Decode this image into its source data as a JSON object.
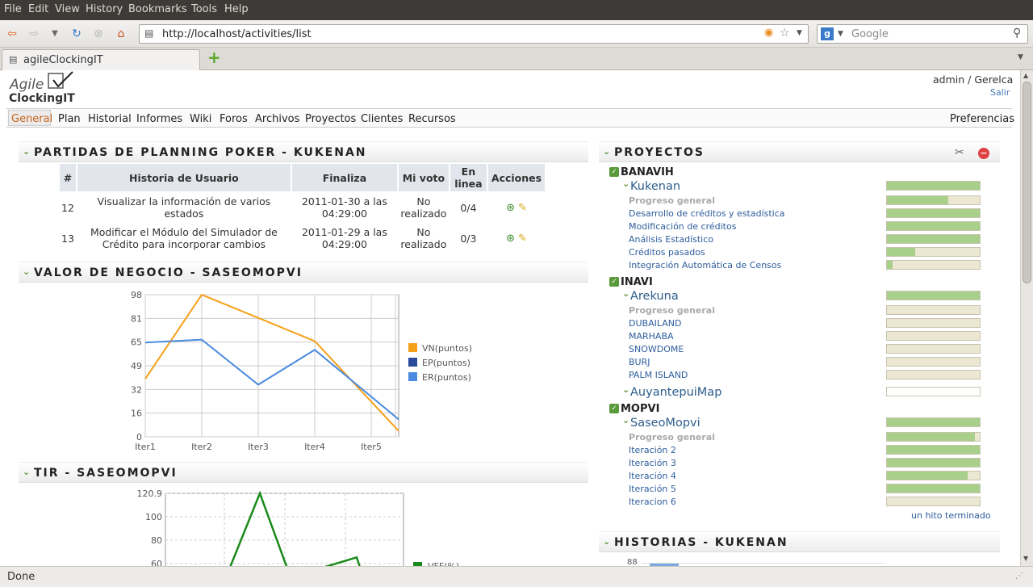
{
  "browser": {
    "menu": [
      "File",
      "Edit",
      "View",
      "History",
      "Bookmarks",
      "Tools",
      "Help"
    ],
    "url": "http://localhost/activities/list",
    "search_placeholder": "Google",
    "tab_title": "agileClockingIT",
    "status": "Done"
  },
  "app": {
    "logo_line1": "Agile",
    "logo_line2": "ClockingIT",
    "user": "admin / Gerelca",
    "logout": "Salir",
    "nav": [
      "General",
      "Plan",
      "Historial",
      "Informes",
      "Wiki",
      "Foros",
      "Archivos",
      "Proyectos",
      "Clientes",
      "Recursos"
    ],
    "preferences": "Preferencias"
  },
  "poker": {
    "title": "PARTIDAS DE PLANNING POKER - KUKENAN",
    "headers": [
      "#",
      "Historia de Usuario",
      "Finaliza",
      "Mi voto",
      "En linea",
      "Acciones"
    ],
    "rows": [
      {
        "id": "12",
        "story": "Visualizar la información de varios estados",
        "ends": "2011-01-30 a las 04:29:00",
        "vote": "No realizado",
        "online": "0/4"
      },
      {
        "id": "13",
        "story": "Modificar el Módulo del Simulador de Crédito para incorporar cambios",
        "ends": "2011-01-29 a las 04:29:00",
        "vote": "No realizado",
        "online": "0/3"
      }
    ]
  },
  "valor": {
    "title": "VALOR DE NEGOCIO - SASEOMOPVI"
  },
  "tir": {
    "title": "TIR - SASEOMOPVI"
  },
  "chart_data": [
    {
      "type": "line",
      "categories": [
        "Iter1",
        "Iter2",
        "Iter3",
        "Iter4",
        "Iter5",
        ""
      ],
      "ylim": [
        0,
        98
      ],
      "yticks": [
        "98",
        "81",
        "65",
        "49",
        "32",
        "16",
        "0"
      ],
      "series": [
        {
          "name": "VN(puntos)",
          "color": "#f5a01a",
          "values": [
            40,
            98,
            82,
            66,
            4
          ]
        },
        {
          "name": "EP(puntos)",
          "color": "#2a4a9a",
          "values": [
            null,
            null,
            null,
            null,
            null
          ]
        },
        {
          "name": "ER(puntos)",
          "color": "#4a8ae0",
          "values": [
            65,
            67,
            36,
            60,
            12
          ]
        }
      ]
    },
    {
      "type": "line",
      "yticks": [
        "120.9",
        "100",
        "80",
        "60"
      ],
      "ylim": [
        60,
        120.9
      ],
      "series": [
        {
          "name": "VFF(%)",
          "color": "#1a8a1a",
          "values": [
            40,
            120.9,
            40,
            65
          ]
        }
      ]
    }
  ],
  "proyectos": {
    "title": "PROYECTOS",
    "clients": [
      {
        "name": "BANAVIH",
        "projects": [
          {
            "name": "Kukenan",
            "progress": 1.0,
            "items": [
              {
                "label": "Progreso general",
                "gray": true,
                "progress": 0.66
              },
              {
                "label": "Desarrollo de créditos y estadística",
                "progress": 1.0
              },
              {
                "label": "Modificación de créditos",
                "progress": 1.0
              },
              {
                "label": "Análisis Estadístico",
                "progress": 1.0
              },
              {
                "label": "Créditos pasados",
                "progress": 0.3
              },
              {
                "label": "Integración Automática de Censos",
                "progress": 0.06
              }
            ]
          }
        ]
      },
      {
        "name": "INAVI",
        "projects": [
          {
            "name": "Arekuna",
            "progress": 1.0,
            "items": [
              {
                "label": "Progreso general",
                "gray": true,
                "progress": 0
              },
              {
                "label": "DUBAILAND",
                "progress": 0
              },
              {
                "label": "MARHABA",
                "progress": 0
              },
              {
                "label": "SNOWDOME",
                "progress": 0
              },
              {
                "label": "BURJ",
                "progress": 0
              },
              {
                "label": "PALM ISLAND",
                "progress": 0
              }
            ]
          },
          {
            "name": "AuyantepuiMap",
            "progress": 0,
            "items": []
          }
        ]
      },
      {
        "name": "MOPVI",
        "projects": [
          {
            "name": "SaseoMopvi",
            "progress": 1.0,
            "items": [
              {
                "label": "Progreso general",
                "gray": true,
                "progress": 0.95
              },
              {
                "label": "Iteración 2",
                "progress": 1.0
              },
              {
                "label": "Iteración 3",
                "progress": 1.0
              },
              {
                "label": "Iteración 4",
                "progress": 0.87
              },
              {
                "label": "Iteración 5",
                "progress": 1.0
              },
              {
                "label": "Iteracion 6",
                "progress": 0
              }
            ]
          }
        ]
      }
    ],
    "milestone_link": "un hito terminado"
  },
  "historias": {
    "title": "HISTORIAS - KUKENAN",
    "first_tick": "88"
  }
}
